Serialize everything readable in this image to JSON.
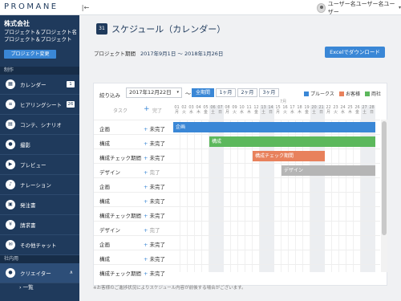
{
  "app": {
    "logo": "PROMANE",
    "collapse_glyph": "|←"
  },
  "user": {
    "name": "ユーザー名ユーザー名ユーザー",
    "caret": "▾"
  },
  "sidebar": {
    "company": "株式会社",
    "project": "プロジェクト＆プロジェクト名プロジェクト＆プロジェクト",
    "change_button": "プロジェクト変更",
    "section_production": "制作",
    "section_internal": "社内用",
    "items": [
      {
        "label": "カレンダー",
        "badge": "1",
        "glyph": "▦"
      },
      {
        "label": "ヒアリングシート",
        "badge": "26",
        "glyph": "≡"
      },
      {
        "label": "コンテ、シナリオ",
        "badge": "",
        "glyph": "▤"
      },
      {
        "label": "撮影",
        "badge": "",
        "glyph": "●"
      },
      {
        "label": "プレビュー",
        "badge": "",
        "glyph": "▶"
      },
      {
        "label": "ナレーション",
        "badge": "",
        "glyph": "♪"
      },
      {
        "label": "発注書",
        "badge": "",
        "glyph": "▣"
      },
      {
        "label": "請求書",
        "badge": "",
        "glyph": "¥"
      },
      {
        "label": "その他チャット",
        "badge": "",
        "glyph": "✉"
      }
    ],
    "creator": {
      "label": "クリエイター",
      "glyph": "●",
      "chevron": "∧"
    },
    "sub_item": "› 一覧"
  },
  "main": {
    "title": "スケジュール（カレンダー）",
    "title_glyph": "31",
    "period_label": "プロジェクト期間",
    "period_value": "2017年9月1日 〜 2018年1月26日",
    "excel_button": "Excelでダウンロード",
    "note": "※お客様のご進捗状況によりスケジュール内容が前後する場合がございます。"
  },
  "filters": {
    "narrow_label": "絞り込み",
    "date": "2017年12月22日",
    "select_caret": "▾",
    "tilde": "〜",
    "ranges": [
      "全期間",
      "1ヶ月",
      "2ヶ月",
      "3ヶ月"
    ],
    "selected_range": "全期間"
  },
  "legend": [
    {
      "label": "プルークス",
      "color": "#3a87d6"
    },
    {
      "label": "お客様",
      "color": "#e8815c"
    },
    {
      "label": "両社",
      "color": "#5cb85c"
    }
  ],
  "gantt": {
    "task_header": "タスク",
    "done_header": "完了",
    "plus": "+",
    "month_label": "7月",
    "days": [
      {
        "d": "01",
        "w": "月"
      },
      {
        "d": "02",
        "w": "火"
      },
      {
        "d": "03",
        "w": "水"
      },
      {
        "d": "04",
        "w": "木"
      },
      {
        "d": "05",
        "w": "金"
      },
      {
        "d": "06",
        "w": "土"
      },
      {
        "d": "07",
        "w": "日"
      },
      {
        "d": "08",
        "w": "月"
      },
      {
        "d": "09",
        "w": "火"
      },
      {
        "d": "10",
        "w": "水"
      },
      {
        "d": "11",
        "w": "木"
      },
      {
        "d": "12",
        "w": "金"
      },
      {
        "d": "13",
        "w": "土"
      },
      {
        "d": "14",
        "w": "日"
      },
      {
        "d": "15",
        "w": "月"
      },
      {
        "d": "16",
        "w": "火"
      },
      {
        "d": "17",
        "w": "水"
      },
      {
        "d": "18",
        "w": "木"
      },
      {
        "d": "19",
        "w": "金"
      },
      {
        "d": "20",
        "w": "土"
      },
      {
        "d": "21",
        "w": "日"
      },
      {
        "d": "22",
        "w": "月"
      },
      {
        "d": "23",
        "w": "火"
      },
      {
        "d": "24",
        "w": "水"
      },
      {
        "d": "25",
        "w": "木"
      },
      {
        "d": "26",
        "w": "金"
      },
      {
        "d": "27",
        "w": "土"
      },
      {
        "d": "28",
        "w": "日"
      }
    ],
    "weekend_days": [
      6,
      7,
      13,
      14,
      20,
      21,
      27,
      28
    ],
    "rows": [
      {
        "name": "企画",
        "status": "未完了",
        "done": false
      },
      {
        "name": "構成",
        "status": "未完了",
        "done": false
      },
      {
        "name": "構成チェック期間",
        "status": "未完了",
        "done": false
      },
      {
        "name": "デザイン",
        "status": "完了",
        "done": true
      },
      {
        "name": "企画",
        "status": "未完了",
        "done": false
      },
      {
        "name": "構成",
        "status": "未完了",
        "done": false
      },
      {
        "name": "構成チェック期間",
        "status": "未完了",
        "done": false
      },
      {
        "name": "デザイン",
        "status": "完了",
        "done": true
      },
      {
        "name": "企画",
        "status": "未完了",
        "done": false
      },
      {
        "name": "構成",
        "status": "未完了",
        "done": false
      },
      {
        "name": "構成チェック期間",
        "status": "未完了",
        "done": false
      }
    ],
    "bars": [
      {
        "row": 0,
        "label": "企画",
        "start": 1,
        "end": 28,
        "color": "#3a87d6"
      },
      {
        "row": 1,
        "label": "構成",
        "start": 6,
        "end": 28,
        "color": "#5cb85c"
      },
      {
        "row": 2,
        "label": "構成チェック期間",
        "start": 12,
        "end": 21,
        "color": "#e8815c"
      },
      {
        "row": 3,
        "label": "デザイン",
        "start": 16,
        "end": 28,
        "color": "#b5b5b5"
      }
    ]
  }
}
